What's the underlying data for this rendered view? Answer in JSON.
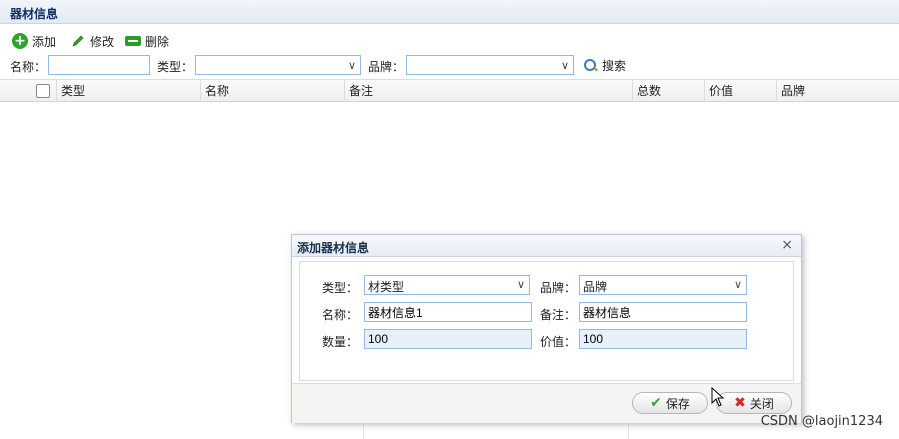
{
  "panel": {
    "title": "器材信息"
  },
  "toolbar": {
    "add_label": "添加",
    "edit_label": "修改",
    "delete_label": "删除"
  },
  "search": {
    "name_label": "名称：",
    "name_value": "",
    "type_label": "类型：",
    "type_value": "",
    "brand_label": "品牌：",
    "brand_value": "",
    "search_label": "搜索"
  },
  "grid": {
    "columns": [
      "类型",
      "名称",
      "备注",
      "总数",
      "价值",
      "品牌"
    ]
  },
  "dialog": {
    "title": "添加器材信息",
    "type_label": "类型：",
    "type_value": "材类型",
    "brand_label": "品牌：",
    "brand_value": "品牌",
    "name_label": "名称：",
    "name_value": "器材信息1",
    "note_label": "备注：",
    "note_value": "器材信息",
    "qty_label": "数量：",
    "qty_value": "100",
    "value_label": "价值：",
    "value_value": "100",
    "save_label": "保存",
    "close_label": "关闭"
  },
  "watermark": "CSDN @laojin1234",
  "colors": {
    "accent": "#95b8e7",
    "header": "#0e2d5f",
    "add_green": "#2da52d",
    "close_red": "#d22222"
  }
}
